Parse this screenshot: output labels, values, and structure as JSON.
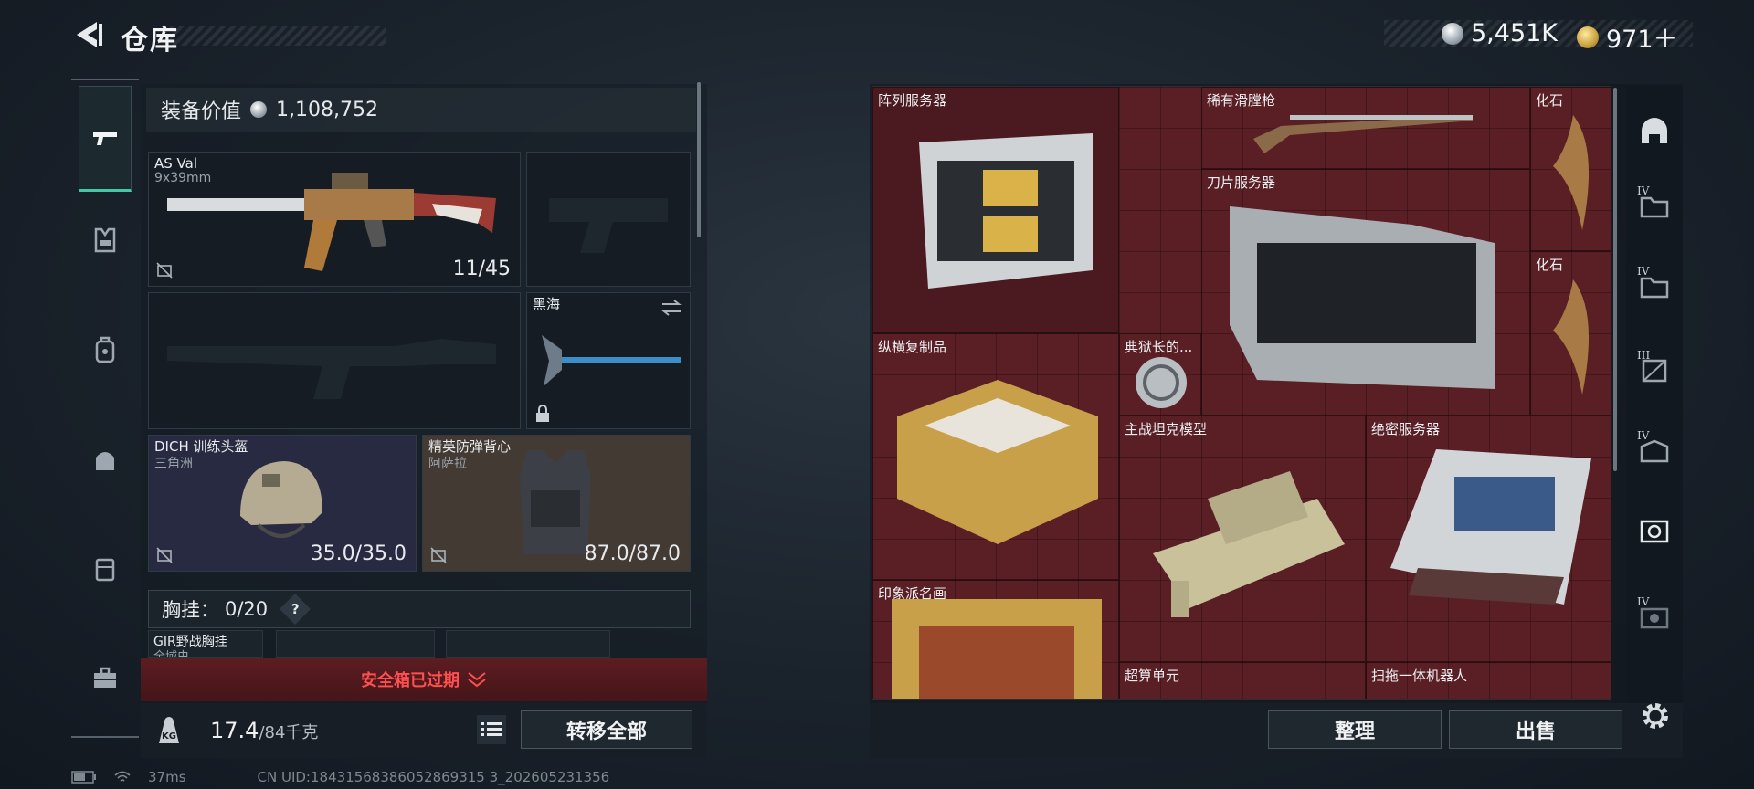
{
  "header": {
    "title": "仓库",
    "currency": [
      {
        "icon": "silver-coin-icon",
        "value": "5,451K"
      },
      {
        "icon": "gold-coin-icon",
        "value": "971＋"
      }
    ]
  },
  "left_nav": {
    "items": [
      "pistol-icon",
      "armor-icon",
      "backpack-icon",
      "bag-icon",
      "container-icon",
      "toolbox-icon"
    ],
    "active": "pistol-icon"
  },
  "equipment": {
    "value_label": "装备价值",
    "value": "1,108,752",
    "primary_weapon": {
      "name": "AS Val",
      "caliber": "9x39mm",
      "ammo": "11/45"
    },
    "melee": {
      "name": "黑海"
    },
    "helmet": {
      "name": "DICH 训练头盔",
      "map": "三角洲",
      "durability": "35.0/35.0"
    },
    "vest": {
      "name": "精英防弹背心",
      "map": "阿萨拉",
      "durability": "87.0/87.0"
    },
    "chest_rig": {
      "label": "胸挂：",
      "value": "0/20",
      "help": "?",
      "item_name": "GIR野战胸挂",
      "item_sub": "全域虫"
    },
    "safebox_text": "安全箱已过期",
    "weight": "17.4",
    "weight_max": "/84千克",
    "transfer_all": "转移全部"
  },
  "storage": {
    "items": [
      {
        "label": "阵列服务器"
      },
      {
        "label": "稀有滑膛枪"
      },
      {
        "label": "化石"
      },
      {
        "label": "刀片服务器"
      },
      {
        "label": "化石"
      },
      {
        "label": "纵横复制品"
      },
      {
        "label": "典狱长的..."
      },
      {
        "label": "主战坦克模型"
      },
      {
        "label": "绝密服务器"
      },
      {
        "label": "印象派名画"
      },
      {
        "label": "超算单元"
      },
      {
        "label": "扫拖一体机器人"
      }
    ],
    "tidy_button": "整理",
    "sell_button": "出售",
    "right_nav": [
      {
        "icon": "dome-icon",
        "tier": ""
      },
      {
        "icon": "folder-iv-icon",
        "tier": "IV"
      },
      {
        "icon": "folder-iv-icon",
        "tier": "IV"
      },
      {
        "icon": "crate-iii-icon",
        "tier": "III"
      },
      {
        "icon": "crate-iv-icon",
        "tier": "IV"
      },
      {
        "icon": "camera-box-icon",
        "tier": ""
      },
      {
        "icon": "camera-iv-icon",
        "tier": "IV"
      },
      {
        "icon": "gear-icon",
        "tier": ""
      }
    ]
  },
  "status_bar": {
    "ping": "37ms",
    "uid": "CN UID:18431568386052869315 3_202605231356"
  },
  "colors": {
    "accent": "#43c7a5",
    "storage_bg": "#5a1e25",
    "warning": "#ff4f4f"
  }
}
